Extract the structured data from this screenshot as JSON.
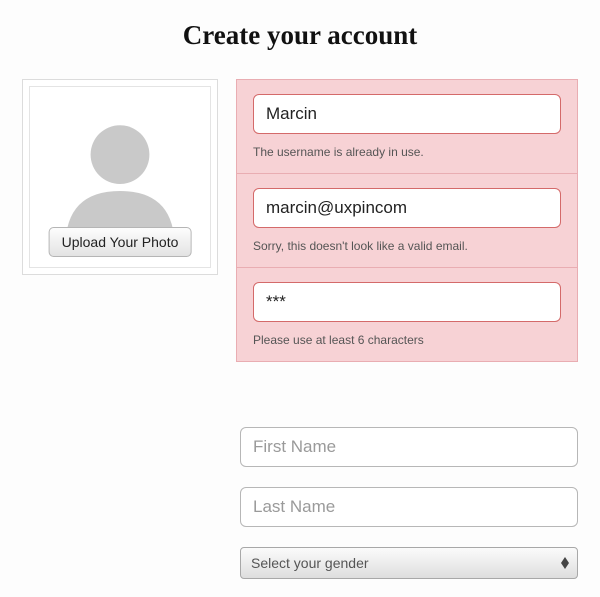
{
  "title": "Create your account",
  "upload_label": "Upload Your Photo",
  "fields": {
    "username": {
      "value": "Marcin",
      "error": "The username is already in use."
    },
    "email": {
      "value": "marcin@uxpincom",
      "error": "Sorry, this doesn't look like a valid email."
    },
    "password": {
      "value": "***",
      "error": "Please use at least 6 characters"
    },
    "first_name": {
      "placeholder": "First Name"
    },
    "last_name": {
      "placeholder": "Last Name"
    },
    "gender": {
      "placeholder": "Select your gender"
    }
  }
}
